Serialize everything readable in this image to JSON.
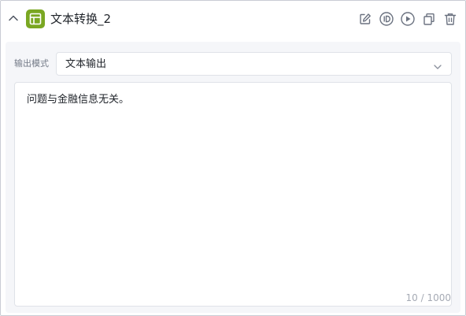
{
  "node": {
    "title": "文本转换_2",
    "icon": "table-layout-icon",
    "accent_color": "#7aa722"
  },
  "header_actions": [
    {
      "name": "edit-icon"
    },
    {
      "name": "id-icon"
    },
    {
      "name": "run-icon"
    },
    {
      "name": "copy-icon"
    },
    {
      "name": "delete-icon"
    }
  ],
  "output_mode": {
    "label": "输出模式",
    "selected": "文本输出"
  },
  "text_output": {
    "content": "问题与金融信息无关。",
    "counter": "10 / 1000"
  }
}
